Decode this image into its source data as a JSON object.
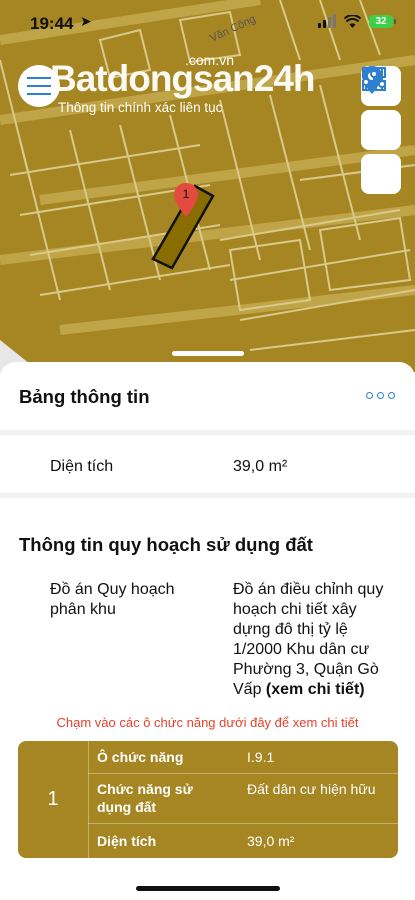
{
  "status": {
    "time": "19:44",
    "battery": "32"
  },
  "map": {
    "street_label": "Văn Công",
    "marker_label": "1",
    "brand_domain": ".com.vn",
    "brand_name": "Batdongsan24h",
    "brand_tagline": "Thông tin chính xác liên tục",
    "colors": {
      "land": "#a68622",
      "lines": "#d9c98a",
      "parcel": "#8a6d00"
    }
  },
  "icons": {
    "menu": "hamburger-icon",
    "layers": "grid-icon",
    "location": "map-pin-icon",
    "filter": "sliders-icon",
    "more": "ellipsis-icon"
  },
  "info": {
    "title": "Bảng thông tin",
    "area_label": "Diện tích",
    "area_value": "39,0 m²"
  },
  "planning": {
    "title": "Thông tin quy hoạch sử dụng đất",
    "plan_label": "Đồ án Quy hoạch phân khu",
    "plan_value": "Đồ án điều chỉnh quy hoạch chi tiết xây dựng đô thị tỷ lệ 1/2000 Khu dân cư Phường 3, Quận Gò Vấp",
    "plan_link": "(xem chi tiết)",
    "hint": "Chạm vào các ô chức năng dưới đây để xem chi tiết",
    "zone": {
      "index": "1",
      "rows": [
        {
          "key": "Ô chức năng",
          "value": "I.9.1"
        },
        {
          "key": "Chức năng sử dụng đất",
          "value": "Đất dân cư hiện hữu"
        },
        {
          "key": "Diện tích",
          "value": "39,0 m²"
        }
      ]
    }
  },
  "accent": "#2f7fd1",
  "hint_color": "#e4412a"
}
